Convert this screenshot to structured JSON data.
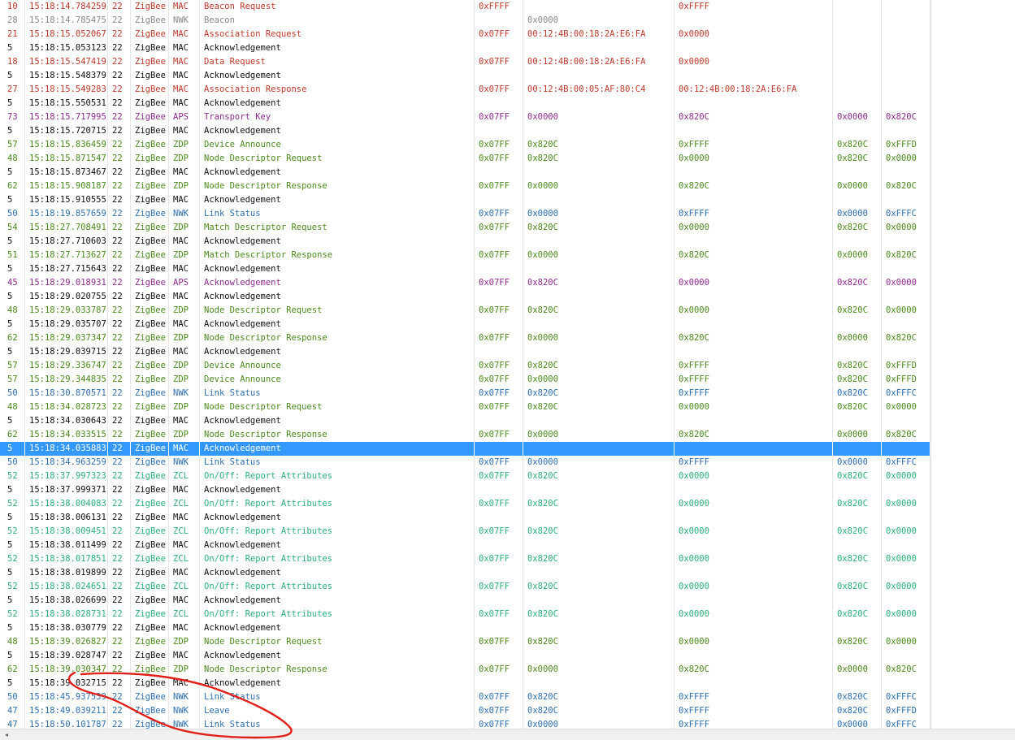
{
  "colors": {
    "MAC_frame": "#c0392b",
    "MAC_ack": "#111111",
    "NWK_beacon": "#888888",
    "NWK": "#2f6fb0",
    "APS": "#8e2b8e",
    "ZDP": "#4b8a1e",
    "ZCL": "#2bb07a",
    "selected_bg": "#3399ff",
    "annotation": "#e0211a"
  },
  "scrollbar": {
    "left_arrow_icon": "◂"
  },
  "rows": [
    {
      "len": "10",
      "time": "15:18:14.784259",
      "ch": "22",
      "pr": "ZigBee",
      "ly": "MAC",
      "info": "Beacon Request",
      "pan": "0xFFFF",
      "src": "",
      "dst": "0xFFFF",
      "n1": "",
      "n2": "",
      "color": "#c0392b"
    },
    {
      "len": "28",
      "time": "15:18:14.785475",
      "ch": "22",
      "pr": "ZigBee",
      "ly": "NWK",
      "info": "Beacon",
      "pan": "",
      "src": "0x0000",
      "dst": "",
      "n1": "",
      "n2": "",
      "color": "#888888"
    },
    {
      "len": "21",
      "time": "15:18:15.052067",
      "ch": "22",
      "pr": "ZigBee",
      "ly": "MAC",
      "info": "Association Request",
      "pan": "0x07FF",
      "src": "00:12:4B:00:18:2A:E6:FA",
      "dst": "0x0000",
      "n1": "",
      "n2": "",
      "color": "#c0392b"
    },
    {
      "len": "5",
      "time": "15:18:15.053123",
      "ch": "22",
      "pr": "ZigBee",
      "ly": "MAC",
      "info": "Acknowledgement",
      "pan": "",
      "src": "",
      "dst": "",
      "n1": "",
      "n2": "",
      "color": "#111111"
    },
    {
      "len": "18",
      "time": "15:18:15.547419",
      "ch": "22",
      "pr": "ZigBee",
      "ly": "MAC",
      "info": "Data Request",
      "pan": "0x07FF",
      "src": "00:12:4B:00:18:2A:E6:FA",
      "dst": "0x0000",
      "n1": "",
      "n2": "",
      "color": "#c0392b"
    },
    {
      "len": "5",
      "time": "15:18:15.548379",
      "ch": "22",
      "pr": "ZigBee",
      "ly": "MAC",
      "info": "Acknowledgement",
      "pan": "",
      "src": "",
      "dst": "",
      "n1": "",
      "n2": "",
      "color": "#111111"
    },
    {
      "len": "27",
      "time": "15:18:15.549283",
      "ch": "22",
      "pr": "ZigBee",
      "ly": "MAC",
      "info": "Association Response",
      "pan": "0x07FF",
      "src": "00:12:4B:00:05:AF:80:C4",
      "dst": "00:12:4B:00:18:2A:E6:FA",
      "n1": "",
      "n2": "",
      "color": "#c0392b"
    },
    {
      "len": "5",
      "time": "15:18:15.550531",
      "ch": "22",
      "pr": "ZigBee",
      "ly": "MAC",
      "info": "Acknowledgement",
      "pan": "",
      "src": "",
      "dst": "",
      "n1": "",
      "n2": "",
      "color": "#111111"
    },
    {
      "len": "73",
      "time": "15:18:15.717995",
      "ch": "22",
      "pr": "ZigBee",
      "ly": "APS",
      "info": "Transport Key",
      "pan": "0x07FF",
      "src": "0x0000",
      "dst": "0x820C",
      "n1": "0x0000",
      "n2": "0x820C",
      "color": "#8e2b8e"
    },
    {
      "len": "5",
      "time": "15:18:15.720715",
      "ch": "22",
      "pr": "ZigBee",
      "ly": "MAC",
      "info": "Acknowledgement",
      "pan": "",
      "src": "",
      "dst": "",
      "n1": "",
      "n2": "",
      "color": "#111111"
    },
    {
      "len": "57",
      "time": "15:18:15.836459",
      "ch": "22",
      "pr": "ZigBee",
      "ly": "ZDP",
      "info": "Device Announce",
      "pan": "0x07FF",
      "src": "0x820C",
      "dst": "0xFFFF",
      "n1": "0x820C",
      "n2": "0xFFFD",
      "color": "#4b8a1e"
    },
    {
      "len": "48",
      "time": "15:18:15.871547",
      "ch": "22",
      "pr": "ZigBee",
      "ly": "ZDP",
      "info": "Node Descriptor Request",
      "pan": "0x07FF",
      "src": "0x820C",
      "dst": "0x0000",
      "n1": "0x820C",
      "n2": "0x0000",
      "color": "#4b8a1e"
    },
    {
      "len": "5",
      "time": "15:18:15.873467",
      "ch": "22",
      "pr": "ZigBee",
      "ly": "MAC",
      "info": "Acknowledgement",
      "pan": "",
      "src": "",
      "dst": "",
      "n1": "",
      "n2": "",
      "color": "#111111"
    },
    {
      "len": "62",
      "time": "15:18:15.908187",
      "ch": "22",
      "pr": "ZigBee",
      "ly": "ZDP",
      "info": "Node Descriptor Response",
      "pan": "0x07FF",
      "src": "0x0000",
      "dst": "0x820C",
      "n1": "0x0000",
      "n2": "0x820C",
      "color": "#4b8a1e"
    },
    {
      "len": "5",
      "time": "15:18:15.910555",
      "ch": "22",
      "pr": "ZigBee",
      "ly": "MAC",
      "info": "Acknowledgement",
      "pan": "",
      "src": "",
      "dst": "",
      "n1": "",
      "n2": "",
      "color": "#111111"
    },
    {
      "len": "50",
      "time": "15:18:19.857659",
      "ch": "22",
      "pr": "ZigBee",
      "ly": "NWK",
      "info": "Link Status",
      "pan": "0x07FF",
      "src": "0x0000",
      "dst": "0xFFFF",
      "n1": "0x0000",
      "n2": "0xFFFC",
      "color": "#2f6fb0"
    },
    {
      "len": "54",
      "time": "15:18:27.708491",
      "ch": "22",
      "pr": "ZigBee",
      "ly": "ZDP",
      "info": "Match Descriptor Request",
      "pan": "0x07FF",
      "src": "0x820C",
      "dst": "0x0000",
      "n1": "0x820C",
      "n2": "0x0000",
      "color": "#4b8a1e"
    },
    {
      "len": "5",
      "time": "15:18:27.710603",
      "ch": "22",
      "pr": "ZigBee",
      "ly": "MAC",
      "info": "Acknowledgement",
      "pan": "",
      "src": "",
      "dst": "",
      "n1": "",
      "n2": "",
      "color": "#111111"
    },
    {
      "len": "51",
      "time": "15:18:27.713627",
      "ch": "22",
      "pr": "ZigBee",
      "ly": "ZDP",
      "info": "Match Descriptor Response",
      "pan": "0x07FF",
      "src": "0x0000",
      "dst": "0x820C",
      "n1": "0x0000",
      "n2": "0x820C",
      "color": "#4b8a1e"
    },
    {
      "len": "5",
      "time": "15:18:27.715643",
      "ch": "22",
      "pr": "ZigBee",
      "ly": "MAC",
      "info": "Acknowledgement",
      "pan": "",
      "src": "",
      "dst": "",
      "n1": "",
      "n2": "",
      "color": "#111111"
    },
    {
      "len": "45",
      "time": "15:18:29.018931",
      "ch": "22",
      "pr": "ZigBee",
      "ly": "APS",
      "info": "Acknowledgement",
      "pan": "0x07FF",
      "src": "0x820C",
      "dst": "0x0000",
      "n1": "0x820C",
      "n2": "0x0000",
      "color": "#8e2b8e"
    },
    {
      "len": "5",
      "time": "15:18:29.020755",
      "ch": "22",
      "pr": "ZigBee",
      "ly": "MAC",
      "info": "Acknowledgement",
      "pan": "",
      "src": "",
      "dst": "",
      "n1": "",
      "n2": "",
      "color": "#111111"
    },
    {
      "len": "48",
      "time": "15:18:29.033787",
      "ch": "22",
      "pr": "ZigBee",
      "ly": "ZDP",
      "info": "Node Descriptor Request",
      "pan": "0x07FF",
      "src": "0x820C",
      "dst": "0x0000",
      "n1": "0x820C",
      "n2": "0x0000",
      "color": "#4b8a1e"
    },
    {
      "len": "5",
      "time": "15:18:29.035707",
      "ch": "22",
      "pr": "ZigBee",
      "ly": "MAC",
      "info": "Acknowledgement",
      "pan": "",
      "src": "",
      "dst": "",
      "n1": "",
      "n2": "",
      "color": "#111111"
    },
    {
      "len": "62",
      "time": "15:18:29.037347",
      "ch": "22",
      "pr": "ZigBee",
      "ly": "ZDP",
      "info": "Node Descriptor Response",
      "pan": "0x07FF",
      "src": "0x0000",
      "dst": "0x820C",
      "n1": "0x0000",
      "n2": "0x820C",
      "color": "#4b8a1e"
    },
    {
      "len": "5",
      "time": "15:18:29.039715",
      "ch": "22",
      "pr": "ZigBee",
      "ly": "MAC",
      "info": "Acknowledgement",
      "pan": "",
      "src": "",
      "dst": "",
      "n1": "",
      "n2": "",
      "color": "#111111"
    },
    {
      "len": "57",
      "time": "15:18:29.336747",
      "ch": "22",
      "pr": "ZigBee",
      "ly": "ZDP",
      "info": "Device Announce",
      "pan": "0x07FF",
      "src": "0x820C",
      "dst": "0xFFFF",
      "n1": "0x820C",
      "n2": "0xFFFD",
      "color": "#4b8a1e"
    },
    {
      "len": "57",
      "time": "15:18:29.344835",
      "ch": "22",
      "pr": "ZigBee",
      "ly": "ZDP",
      "info": "Device Announce",
      "pan": "0x07FF",
      "src": "0x0000",
      "dst": "0xFFFF",
      "n1": "0x820C",
      "n2": "0xFFFD",
      "color": "#4b8a1e"
    },
    {
      "len": "50",
      "time": "15:18:30.870571",
      "ch": "22",
      "pr": "ZigBee",
      "ly": "NWK",
      "info": "Link Status",
      "pan": "0x07FF",
      "src": "0x820C",
      "dst": "0xFFFF",
      "n1": "0x820C",
      "n2": "0xFFFC",
      "color": "#2f6fb0"
    },
    {
      "len": "48",
      "time": "15:18:34.028723",
      "ch": "22",
      "pr": "ZigBee",
      "ly": "ZDP",
      "info": "Node Descriptor Request",
      "pan": "0x07FF",
      "src": "0x820C",
      "dst": "0x0000",
      "n1": "0x820C",
      "n2": "0x0000",
      "color": "#4b8a1e"
    },
    {
      "len": "5",
      "time": "15:18:34.030643",
      "ch": "22",
      "pr": "ZigBee",
      "ly": "MAC",
      "info": "Acknowledgement",
      "pan": "",
      "src": "",
      "dst": "",
      "n1": "",
      "n2": "",
      "color": "#111111"
    },
    {
      "len": "62",
      "time": "15:18:34.033515",
      "ch": "22",
      "pr": "ZigBee",
      "ly": "ZDP",
      "info": "Node Descriptor Response",
      "pan": "0x07FF",
      "src": "0x0000",
      "dst": "0x820C",
      "n1": "0x0000",
      "n2": "0x820C",
      "color": "#4b8a1e"
    },
    {
      "len": "5",
      "time": "15:18:34.035883",
      "ch": "22",
      "pr": "ZigBee",
      "ly": "MAC",
      "info": "Acknowledgement",
      "pan": "",
      "src": "",
      "dst": "",
      "n1": "",
      "n2": "",
      "color": "#111111",
      "selected": true
    },
    {
      "len": "50",
      "time": "15:18:34.963259",
      "ch": "22",
      "pr": "ZigBee",
      "ly": "NWK",
      "info": "Link Status",
      "pan": "0x07FF",
      "src": "0x0000",
      "dst": "0xFFFF",
      "n1": "0x0000",
      "n2": "0xFFFC",
      "color": "#2f6fb0"
    },
    {
      "len": "52",
      "time": "15:18:37.997323",
      "ch": "22",
      "pr": "ZigBee",
      "ly": "ZCL",
      "info": "On/Off: Report Attributes",
      "pan": "0x07FF",
      "src": "0x820C",
      "dst": "0x0000",
      "n1": "0x820C",
      "n2": "0x0000",
      "color": "#2bb07a"
    },
    {
      "len": "5",
      "time": "15:18:37.999371",
      "ch": "22",
      "pr": "ZigBee",
      "ly": "MAC",
      "info": "Acknowledgement",
      "pan": "",
      "src": "",
      "dst": "",
      "n1": "",
      "n2": "",
      "color": "#111111"
    },
    {
      "len": "52",
      "time": "15:18:38.004083",
      "ch": "22",
      "pr": "ZigBee",
      "ly": "ZCL",
      "info": "On/Off: Report Attributes",
      "pan": "0x07FF",
      "src": "0x820C",
      "dst": "0x0000",
      "n1": "0x820C",
      "n2": "0x0000",
      "color": "#2bb07a"
    },
    {
      "len": "5",
      "time": "15:18:38.006131",
      "ch": "22",
      "pr": "ZigBee",
      "ly": "MAC",
      "info": "Acknowledgement",
      "pan": "",
      "src": "",
      "dst": "",
      "n1": "",
      "n2": "",
      "color": "#111111"
    },
    {
      "len": "52",
      "time": "15:18:38.009451",
      "ch": "22",
      "pr": "ZigBee",
      "ly": "ZCL",
      "info": "On/Off: Report Attributes",
      "pan": "0x07FF",
      "src": "0x820C",
      "dst": "0x0000",
      "n1": "0x820C",
      "n2": "0x0000",
      "color": "#2bb07a"
    },
    {
      "len": "5",
      "time": "15:18:38.011499",
      "ch": "22",
      "pr": "ZigBee",
      "ly": "MAC",
      "info": "Acknowledgement",
      "pan": "",
      "src": "",
      "dst": "",
      "n1": "",
      "n2": "",
      "color": "#111111"
    },
    {
      "len": "52",
      "time": "15:18:38.017851",
      "ch": "22",
      "pr": "ZigBee",
      "ly": "ZCL",
      "info": "On/Off: Report Attributes",
      "pan": "0x07FF",
      "src": "0x820C",
      "dst": "0x0000",
      "n1": "0x820C",
      "n2": "0x0000",
      "color": "#2bb07a"
    },
    {
      "len": "5",
      "time": "15:18:38.019899",
      "ch": "22",
      "pr": "ZigBee",
      "ly": "MAC",
      "info": "Acknowledgement",
      "pan": "",
      "src": "",
      "dst": "",
      "n1": "",
      "n2": "",
      "color": "#111111"
    },
    {
      "len": "52",
      "time": "15:18:38.024651",
      "ch": "22",
      "pr": "ZigBee",
      "ly": "ZCL",
      "info": "On/Off: Report Attributes",
      "pan": "0x07FF",
      "src": "0x820C",
      "dst": "0x0000",
      "n1": "0x820C",
      "n2": "0x0000",
      "color": "#2bb07a"
    },
    {
      "len": "5",
      "time": "15:18:38.026699",
      "ch": "22",
      "pr": "ZigBee",
      "ly": "MAC",
      "info": "Acknowledgement",
      "pan": "",
      "src": "",
      "dst": "",
      "n1": "",
      "n2": "",
      "color": "#111111"
    },
    {
      "len": "52",
      "time": "15:18:38.028731",
      "ch": "22",
      "pr": "ZigBee",
      "ly": "ZCL",
      "info": "On/Off: Report Attributes",
      "pan": "0x07FF",
      "src": "0x820C",
      "dst": "0x0000",
      "n1": "0x820C",
      "n2": "0x0000",
      "color": "#2bb07a"
    },
    {
      "len": "5",
      "time": "15:18:38.030779",
      "ch": "22",
      "pr": "ZigBee",
      "ly": "MAC",
      "info": "Acknowledgement",
      "pan": "",
      "src": "",
      "dst": "",
      "n1": "",
      "n2": "",
      "color": "#111111"
    },
    {
      "len": "48",
      "time": "15:18:39.026827",
      "ch": "22",
      "pr": "ZigBee",
      "ly": "ZDP",
      "info": "Node Descriptor Request",
      "pan": "0x07FF",
      "src": "0x820C",
      "dst": "0x0000",
      "n1": "0x820C",
      "n2": "0x0000",
      "color": "#4b8a1e"
    },
    {
      "len": "5",
      "time": "15:18:39.028747",
      "ch": "22",
      "pr": "ZigBee",
      "ly": "MAC",
      "info": "Acknowledgement",
      "pan": "",
      "src": "",
      "dst": "",
      "n1": "",
      "n2": "",
      "color": "#111111"
    },
    {
      "len": "62",
      "time": "15:18:39.030347",
      "ch": "22",
      "pr": "ZigBee",
      "ly": "ZDP",
      "info": "Node Descriptor Response",
      "pan": "0x07FF",
      "src": "0x0000",
      "dst": "0x820C",
      "n1": "0x0000",
      "n2": "0x820C",
      "color": "#4b8a1e"
    },
    {
      "len": "5",
      "time": "15:18:39.032715",
      "ch": "22",
      "pr": "ZigBee",
      "ly": "MAC",
      "info": "Acknowledgement",
      "pan": "",
      "src": "",
      "dst": "",
      "n1": "",
      "n2": "",
      "color": "#111111"
    },
    {
      "len": "50",
      "time": "15:18:45.937539",
      "ch": "22",
      "pr": "ZigBee",
      "ly": "NWK",
      "info": "Link Status",
      "pan": "0x07FF",
      "src": "0x820C",
      "dst": "0xFFFF",
      "n1": "0x820C",
      "n2": "0xFFFC",
      "color": "#2f6fb0"
    },
    {
      "len": "47",
      "time": "15:18:49.039211",
      "ch": "22",
      "pr": "ZigBee",
      "ly": "NWK",
      "info": "Leave",
      "pan": "0x07FF",
      "src": "0x820C",
      "dst": "0xFFFF",
      "n1": "0x820C",
      "n2": "0xFFFD",
      "color": "#2f6fb0"
    },
    {
      "len": "47",
      "time": "15:18:50.101787",
      "ch": "22",
      "pr": "ZigBee",
      "ly": "NWK",
      "info": "Link Status",
      "pan": "0x07FF",
      "src": "0x0000",
      "dst": "0xFFFF",
      "n1": "0x0000",
      "n2": "0xFFFC",
      "color": "#2f6fb0"
    }
  ]
}
